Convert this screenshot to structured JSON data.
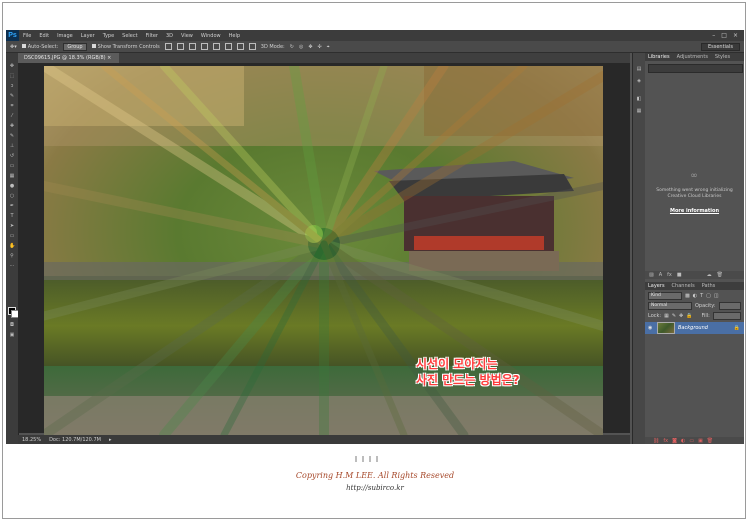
{
  "app": {
    "logo": "Ps",
    "menu": [
      "File",
      "Edit",
      "Image",
      "Layer",
      "Type",
      "Select",
      "Filter",
      "3D",
      "View",
      "Window",
      "Help"
    ],
    "window_controls": [
      "–",
      "□",
      "×"
    ]
  },
  "options": {
    "auto_select_label": "Auto-Select:",
    "auto_select_value": "Group",
    "transform_label": "Show Transform Controls",
    "mode_3d_label": "3D Mode:",
    "workspace": "Essentials"
  },
  "document": {
    "tab_title": "DSC09615.JPG @ 18.3% (RGB/8)",
    "zoom": "18.25%",
    "doc_info": "Doc: 120.7M/120.7M"
  },
  "libraries": {
    "tabs": [
      "Libraries",
      "Adjustments",
      "Styles"
    ],
    "message_line1": "Something went wrong initializing",
    "message_line2": "Creative Cloud Libraries",
    "link": "More information"
  },
  "layers": {
    "tabs": [
      "Layers",
      "Channels",
      "Paths"
    ],
    "kind_label": "Kind",
    "blend_mode": "Normal",
    "opacity_label": "Opacity:",
    "lock_label": "Lock:",
    "fill_label": "Fill:",
    "layer_name": "Background"
  },
  "photo_overlay": {
    "line1": "시선이 모아지는",
    "line2": "사진 만드는 방법은?"
  },
  "footer": {
    "copyright": "Copyring H.M LEE. All Rights Reseved",
    "url": "http://subirco.kr"
  },
  "colors": {
    "overlay_text": "#ff3b3b",
    "copyright": "#a6482a",
    "ps_bg": "#535353",
    "selected_layer": "#4a6fa5"
  }
}
